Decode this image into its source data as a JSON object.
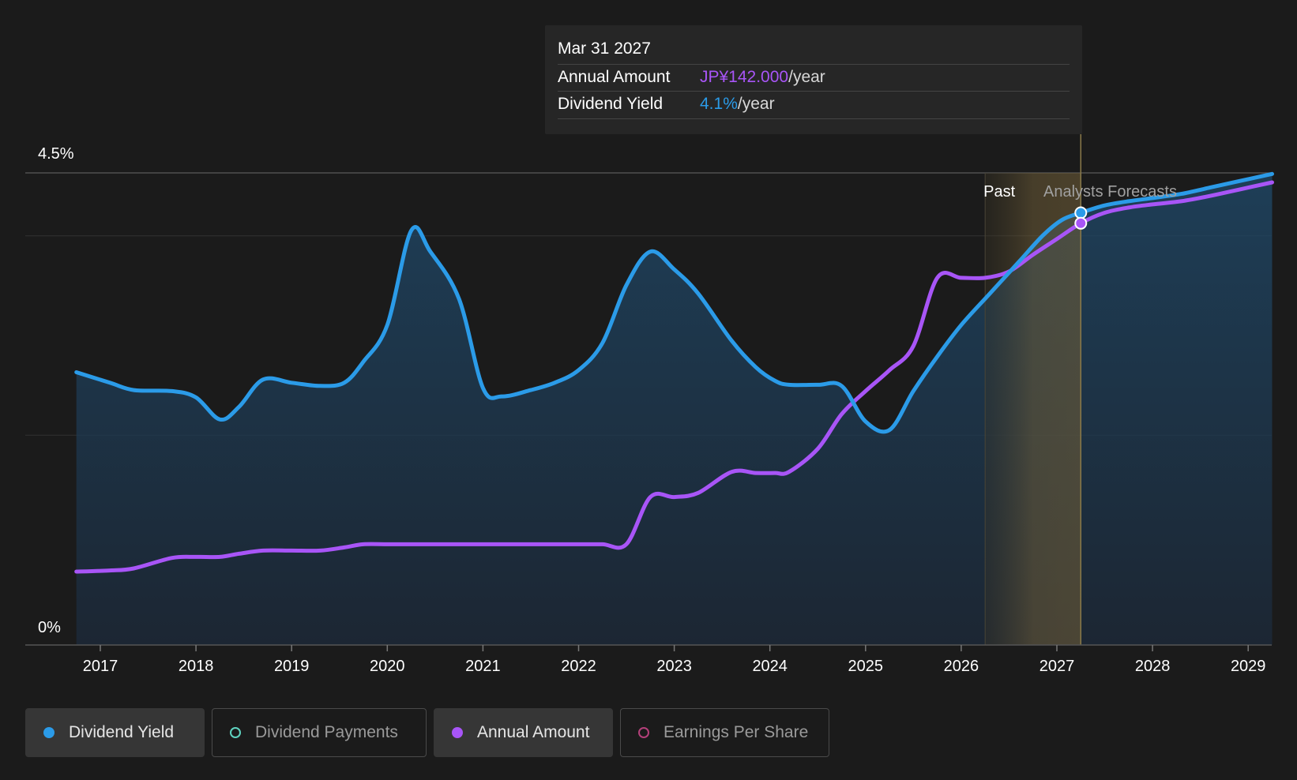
{
  "chart_data": {
    "type": "area",
    "y_axis": {
      "top_label": "4.5%",
      "bottom_label": "0%",
      "ylim": [
        0,
        4.5
      ]
    },
    "x_axis": {
      "tick_labels": [
        "2017",
        "2018",
        "2019",
        "2020",
        "2021",
        "2022",
        "2023",
        "2024",
        "2025",
        "2026",
        "2027",
        "2028",
        "2029"
      ]
    },
    "regions": {
      "past_label": "Past",
      "forecast_label": "Analysts Forecasts"
    },
    "series": [
      {
        "name": "Dividend Yield",
        "color": "#2b9be8",
        "filled": true,
        "x": [
          2016.75,
          2017.1,
          2017.35,
          2017.75,
          2018.0,
          2018.25,
          2018.45,
          2018.7,
          2019.0,
          2019.3,
          2019.55,
          2019.75,
          2020.0,
          2020.25,
          2020.45,
          2020.75,
          2021.0,
          2021.2,
          2021.5,
          2021.75,
          2022.0,
          2022.25,
          2022.5,
          2022.75,
          2023.0,
          2023.25,
          2023.6,
          2023.85,
          2024.05,
          2024.2,
          2024.5,
          2024.75,
          2025.0,
          2025.25,
          2025.5,
          2025.75,
          2026.0,
          2026.3,
          2026.6,
          2026.85,
          2027.05,
          2027.25,
          2027.5,
          2027.75,
          2028.0,
          2028.3,
          2028.6,
          2028.9,
          2029.25
        ],
        "y": [
          2.6,
          2.5,
          2.43,
          2.42,
          2.36,
          2.15,
          2.27,
          2.53,
          2.5,
          2.47,
          2.5,
          2.7,
          3.05,
          3.95,
          3.75,
          3.3,
          2.45,
          2.37,
          2.43,
          2.5,
          2.62,
          2.88,
          3.43,
          3.75,
          3.58,
          3.35,
          2.9,
          2.65,
          2.52,
          2.48,
          2.48,
          2.47,
          2.13,
          2.05,
          2.42,
          2.75,
          3.05,
          3.35,
          3.65,
          3.9,
          4.05,
          4.12,
          4.19,
          4.23,
          4.26,
          4.3,
          4.36,
          4.42,
          4.49
        ]
      },
      {
        "name": "Annual Amount",
        "color": "#a855f7",
        "filled": false,
        "x": [
          2016.75,
          2017.1,
          2017.35,
          2017.75,
          2018.0,
          2018.25,
          2018.45,
          2018.7,
          2019.0,
          2019.3,
          2019.55,
          2019.75,
          2020.0,
          2020.25,
          2020.5,
          2020.75,
          2021.0,
          2021.25,
          2021.5,
          2021.75,
          2022.0,
          2022.25,
          2022.5,
          2022.75,
          2023.0,
          2023.25,
          2023.6,
          2023.85,
          2024.05,
          2024.2,
          2024.5,
          2024.75,
          2025.0,
          2025.25,
          2025.5,
          2025.75,
          2026.0,
          2026.25,
          2026.5,
          2026.75,
          2027.0,
          2027.25,
          2027.5,
          2027.75,
          2028.0,
          2028.3,
          2028.6,
          2028.9,
          2029.25
        ],
        "y": [
          0.7,
          0.71,
          0.73,
          0.83,
          0.84,
          0.84,
          0.87,
          0.9,
          0.9,
          0.9,
          0.93,
          0.96,
          0.96,
          0.96,
          0.96,
          0.96,
          0.96,
          0.96,
          0.96,
          0.96,
          0.96,
          0.96,
          0.96,
          1.41,
          1.41,
          1.45,
          1.65,
          1.64,
          1.64,
          1.65,
          1.87,
          2.2,
          2.42,
          2.62,
          2.85,
          3.5,
          3.5,
          3.5,
          3.56,
          3.72,
          3.87,
          4.02,
          4.12,
          4.17,
          4.2,
          4.23,
          4.28,
          4.34,
          4.41
        ]
      }
    ],
    "highlight": {
      "x": 2027.25,
      "label_date": "Mar 31 2027"
    }
  },
  "tooltip": {
    "date": "Mar 31 2027",
    "rows": [
      {
        "label": "Annual Amount",
        "value": "JP¥142.000",
        "unit": "/year"
      },
      {
        "label": "Dividend Yield",
        "value": "4.1%",
        "unit": "/year"
      }
    ]
  },
  "legend": [
    {
      "label": "Dividend Yield",
      "color": "#2b9be8",
      "active": true,
      "filled": true
    },
    {
      "label": "Dividend Payments",
      "color": "#5fd3c0",
      "active": false,
      "filled": false
    },
    {
      "label": "Annual Amount",
      "color": "#a855f7",
      "active": true,
      "filled": true
    },
    {
      "label": "Earnings Per Share",
      "color": "#b4407a",
      "active": false,
      "filled": false
    }
  ]
}
